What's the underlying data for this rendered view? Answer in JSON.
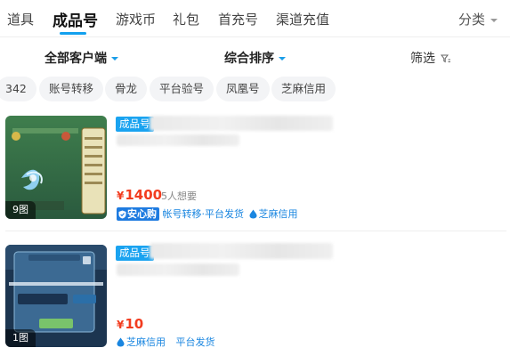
{
  "tabs": [
    {
      "label": "道具"
    },
    {
      "label": "成品号"
    },
    {
      "label": "游戏币"
    },
    {
      "label": "礼包"
    },
    {
      "label": "首充号"
    },
    {
      "label": "渠道充值"
    }
  ],
  "category": {
    "label": "分类"
  },
  "filters": {
    "client": "全部客户端",
    "sort": "综合排序",
    "filter": "筛选"
  },
  "chips": [
    "342",
    "账号转移",
    "骨龙",
    "平台验号",
    "凤凰号",
    "芝麻信用"
  ],
  "listings": [
    {
      "tag": "成品号",
      "image_count": "9图",
      "price_symbol": "¥",
      "price": "1400",
      "wants": "5人想要",
      "badges": {
        "anxin": "安心购",
        "transfer": "帐号转移·平台发货",
        "zhima": "芝麻信用"
      }
    },
    {
      "tag": "成品号",
      "image_count": "1图",
      "price_symbol": "¥",
      "price": "10",
      "badges": {
        "zhima": "芝麻信用",
        "delivery": "平台发货"
      }
    }
  ],
  "colors": {
    "accent": "#12a0ee",
    "price": "#f23c1f",
    "badge_blue": "#1e7be0"
  }
}
